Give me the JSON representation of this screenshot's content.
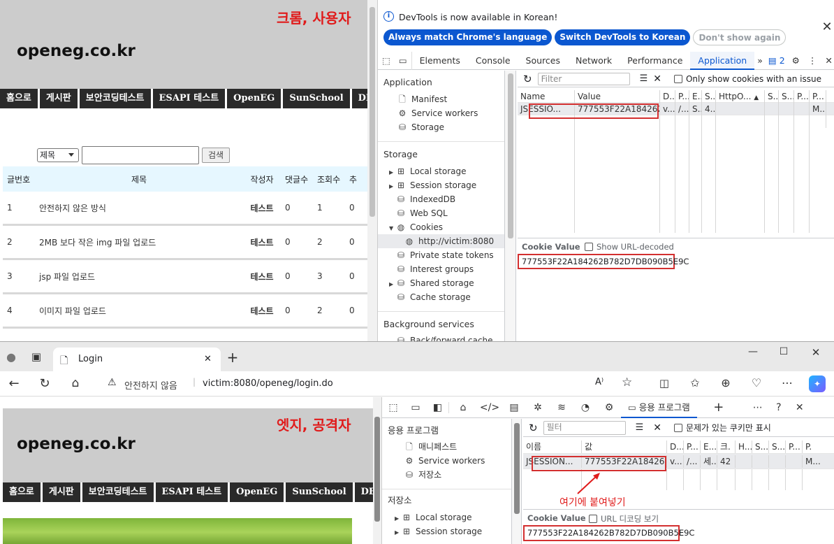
{
  "top_site": {
    "logo": "openeg.co.kr",
    "label": "크롬, 사용자",
    "nav": [
      "홈으로",
      "게시판",
      "보안코딩테스트",
      "ESAPI 테스트",
      "OpenEG",
      "SunSchool",
      "DB초"
    ],
    "search_select": "제목",
    "search_button": "검색",
    "table_headers": [
      "글번호",
      "제목",
      "작성자",
      "댓글수",
      "조회수",
      "추"
    ],
    "rows": [
      {
        "no": "1",
        "title": "안전하지 않은 방식",
        "author": "테스트",
        "comments": "0",
        "views": "1",
        "rec": "0"
      },
      {
        "no": "2",
        "title": "2MB 보다 작은 img 파일 업로드",
        "author": "테스트",
        "comments": "0",
        "views": "2",
        "rec": "0"
      },
      {
        "no": "3",
        "title": "jsp 파일 업로드",
        "author": "테스트",
        "comments": "0",
        "views": "3",
        "rec": "0"
      },
      {
        "no": "4",
        "title": "이미지 파일 업로드",
        "author": "테스트",
        "comments": "0",
        "views": "2",
        "rec": "0"
      }
    ]
  },
  "devtools_top": {
    "infobar_text": "DevTools is now available in Korean!",
    "btn_match": "Always match Chrome's language",
    "btn_switch": "Switch DevTools to Korean",
    "btn_dont": "Don't show again",
    "tabs": [
      "Elements",
      "Console",
      "Sources",
      "Network",
      "Performance",
      "Application"
    ],
    "issues_count": "2",
    "sidebar": {
      "app_title": "Application",
      "app_items": [
        "Manifest",
        "Service workers",
        "Storage"
      ],
      "storage_title": "Storage",
      "storage_items": [
        "Local storage",
        "Session storage",
        "IndexedDB",
        "Web SQL",
        "Cookies",
        "http://victim:8080",
        "Private state tokens",
        "Interest groups",
        "Shared storage",
        "Cache storage"
      ],
      "bg_title": "Background services",
      "bg_partial": "Back/forward cache"
    },
    "filter_placeholder": "Filter",
    "only_issue_label": "Only show cookies with an issue",
    "columns": [
      "Name",
      "Value",
      "D...",
      "P...",
      "E...",
      "S...",
      "HttpO...",
      "S...",
      "S...",
      "P...",
      "P..."
    ],
    "cookie_row": [
      "JSESSIO...",
      "777553F22A184262...",
      "v...",
      "/...",
      "S...",
      "4...",
      "",
      "",
      "",
      "",
      "M..."
    ],
    "cookie_value_title": "Cookie Value",
    "show_decoded": "Show URL-decoded",
    "cookie_value": "777553F22A184262B782D7DB090B5E9C"
  },
  "edge": {
    "tab_title": "Login",
    "not_secure": "안전하지 않음",
    "url": "victim:8080/openeg/login.do",
    "site_logo": "openeg.co.kr",
    "label": "엣지, 공격자",
    "nav": [
      "홈으로",
      "게시판",
      "보안코딩테스트",
      "ESAPI 테스트",
      "OpenEG",
      "SunSchool",
      "DB초"
    ],
    "dev_tab": "응용 프로그램",
    "sidebar": {
      "app_title": "응용 프로그램",
      "app_items": [
        "매니페스트",
        "Service workers",
        "저장소"
      ],
      "storage_title": "저장소",
      "storage_items": [
        "Local storage",
        "Session storage"
      ]
    },
    "filter_placeholder": "필터",
    "only_issue_label": "문제가 있는 쿠키만 표시",
    "columns": [
      "이름",
      "값",
      "D...",
      "P...",
      "E...",
      "크.",
      "H...",
      "S...",
      "S...",
      "P...",
      "P."
    ],
    "cookie_row": [
      "JSESSION...",
      "777553F22A18426...",
      "v...",
      "/...",
      "세...",
      "42",
      "",
      "",
      "",
      "",
      "M..."
    ],
    "annotation": "여기에 붙여넣기",
    "cookie_value_title": "Cookie Value",
    "show_decoded": "URL 디코딩 보기",
    "cookie_value": "777553F22A184262B782D7DB090B5E9C"
  },
  "colors": {
    "red": "#e01b1b",
    "blue": "#0b57d0",
    "nav_bg": "#2a2a2a"
  }
}
